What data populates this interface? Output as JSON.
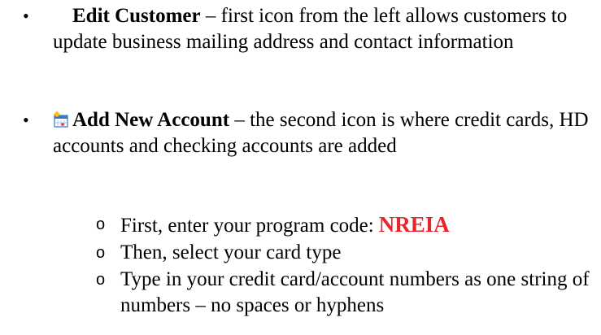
{
  "items": [
    {
      "bullet": "•",
      "title": "Edit Customer",
      "body": " – first icon from the left allows customers to update business mailing address and contact information"
    },
    {
      "bullet": "•",
      "icon": "calendar-sparkle-icon",
      "title": "Add New Account",
      "body": " – the second icon is where credit cards, HD accounts and checking accounts are added",
      "subitems": [
        {
          "bullet": "o",
          "text": "First, enter your program code:",
          "code": "NREIA"
        },
        {
          "bullet": "o",
          "text": "Then, select your card type"
        },
        {
          "bullet": "o",
          "text": "Type in your credit card/account numbers as one string of numbers – no spaces or hyphens"
        }
      ]
    }
  ],
  "colors": {
    "text": "#000000",
    "code": "#e8262a",
    "icon_blue": "#3a78c8",
    "icon_yellow": "#f4c21a"
  }
}
